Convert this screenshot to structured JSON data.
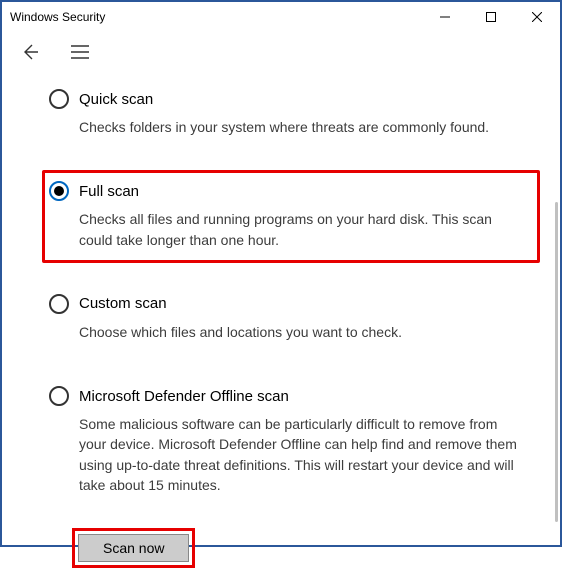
{
  "window": {
    "title": "Windows Security"
  },
  "options": [
    {
      "label": "Quick scan",
      "desc": "Checks folders in your system where threats are commonly found."
    },
    {
      "label": "Full scan",
      "desc": "Checks all files and running programs on your hard disk. This scan could take longer than one hour."
    },
    {
      "label": "Custom scan",
      "desc": "Choose which files and locations you want to check."
    },
    {
      "label": "Microsoft Defender Offline scan",
      "desc": "Some malicious software can be particularly difficult to remove from your device. Microsoft Defender Offline can help find and remove them using up-to-date threat definitions. This will restart your device and will take about 15 minutes."
    }
  ],
  "action": {
    "scan_now": "Scan now"
  }
}
